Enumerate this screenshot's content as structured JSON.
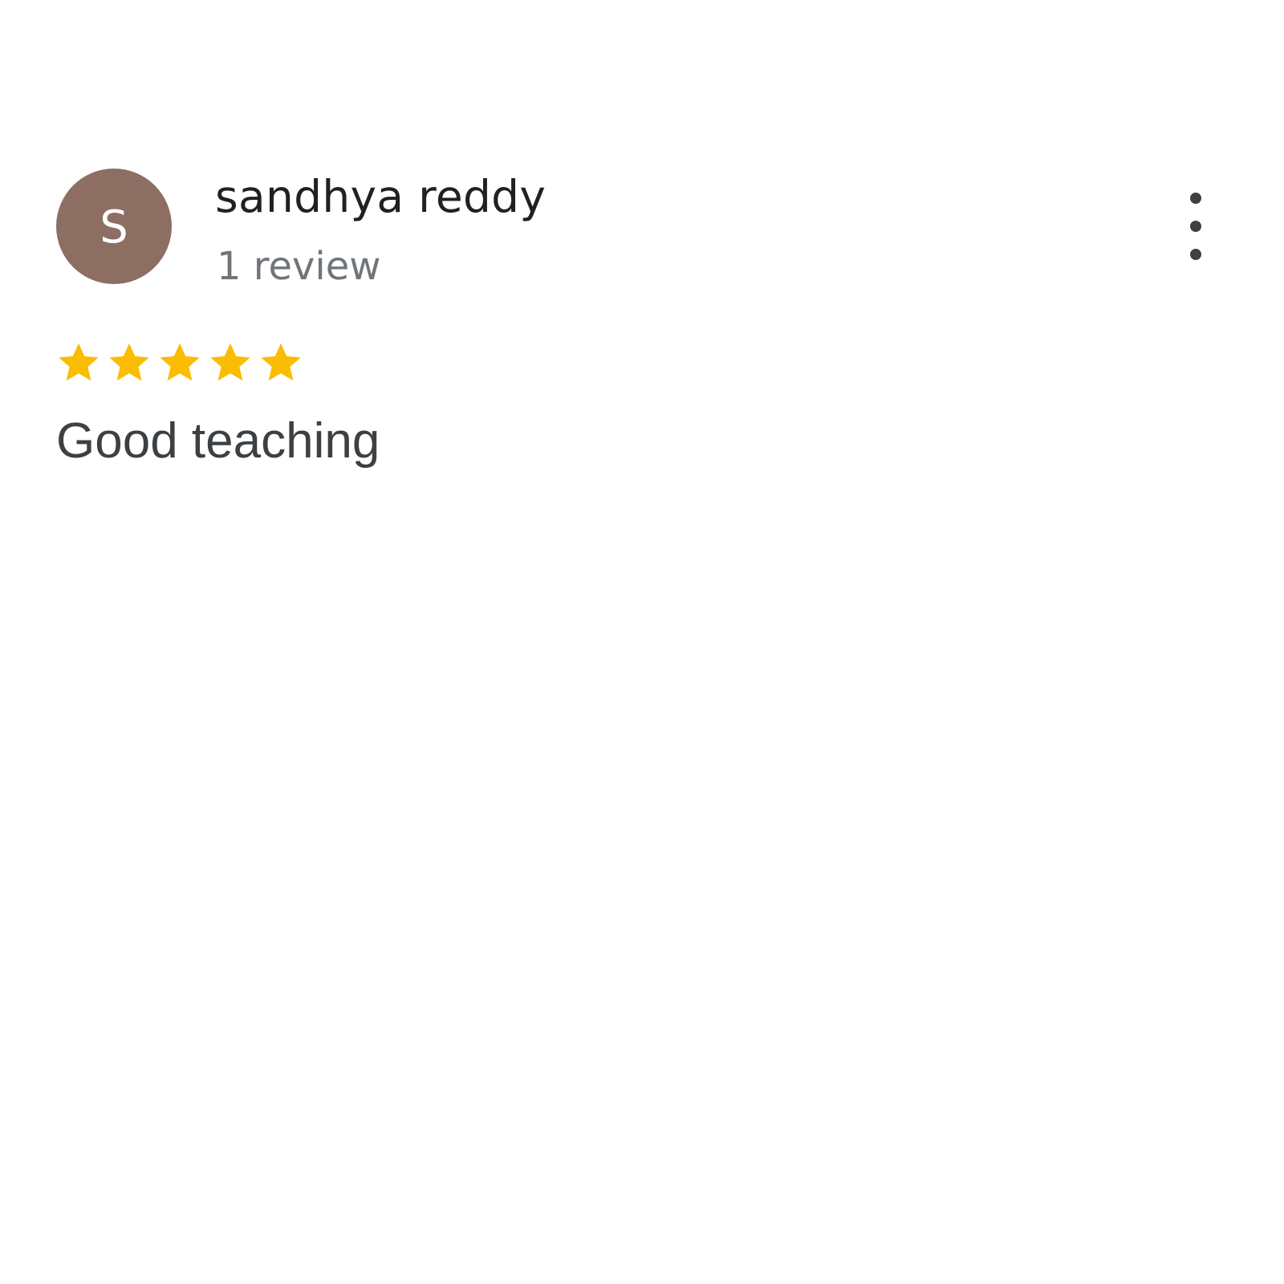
{
  "review": {
    "avatar_initial": "S",
    "avatar_color": "#8d6e63",
    "reviewer_name": "sandhya reddy",
    "review_count": "1 review",
    "rating": 5,
    "rating_max": 5,
    "star_color": "#fbbc04",
    "text": "Good teaching"
  },
  "icons": {
    "more": "more-vertical-icon",
    "star": "star-icon"
  }
}
